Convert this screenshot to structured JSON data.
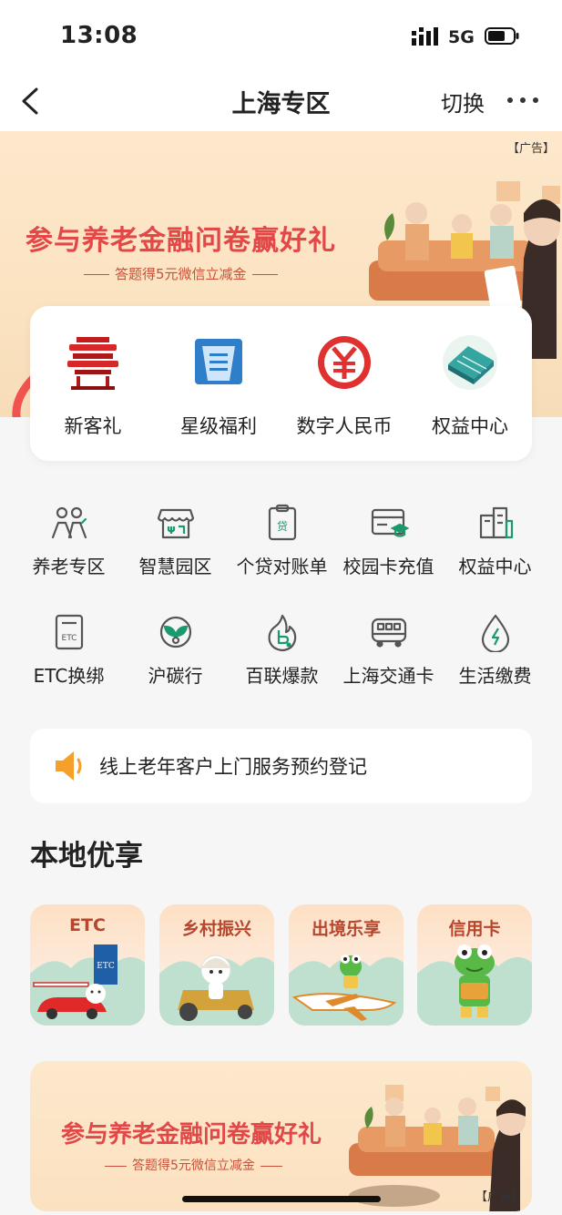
{
  "status_bar": {
    "time": "13:08",
    "network": "5G"
  },
  "nav": {
    "title": "上海专区",
    "switch_label": "切换"
  },
  "banner": {
    "title": "参与养老金融问卷赢好礼",
    "subtitle": "答题得5元微信立减金",
    "ad_tag": "【广告】"
  },
  "top_card": {
    "items": [
      {
        "label": "新客礼",
        "icon": "red-pavilion-icon"
      },
      {
        "label": "星级福利",
        "icon": "blue-building-card-icon"
      },
      {
        "label": "数字人民币",
        "icon": "digital-yuan-icon"
      },
      {
        "label": "权益中心",
        "icon": "teal-building-icon"
      }
    ]
  },
  "services": {
    "row1": [
      {
        "label": "养老专区",
        "icon": "elderly-couple-icon"
      },
      {
        "label": "智慧园区",
        "icon": "shop-icon"
      },
      {
        "label": "个贷对账单",
        "icon": "loan-statement-icon"
      },
      {
        "label": "校园卡充值",
        "icon": "campus-card-icon"
      },
      {
        "label": "权益中心",
        "icon": "buildings-icon"
      }
    ],
    "row2": [
      {
        "label": "ETC换绑",
        "icon": "etc-card-icon"
      },
      {
        "label": "沪碳行",
        "icon": "carbon-leaf-icon"
      },
      {
        "label": "百联爆款",
        "icon": "fire-b-icon"
      },
      {
        "label": "上海交通卡",
        "icon": "bus-icon"
      },
      {
        "label": "生活缴费",
        "icon": "water-drop-icon"
      }
    ],
    "etc_glyph_text": "ETC",
    "loan_glyph_text": "贷"
  },
  "notice": {
    "text": "线上老年客户上门服务预约登记"
  },
  "local": {
    "title": "本地优享",
    "tiles": [
      {
        "label": "ETC"
      },
      {
        "label": "乡村振兴"
      },
      {
        "label": "出境乐享"
      },
      {
        "label": "信用卡"
      }
    ],
    "etc_sign": "ETC"
  },
  "banner2": {
    "title": "参与养老金融问卷赢好礼",
    "subtitle": "答题得5元微信立减金",
    "ad_tag": "【广告】"
  },
  "colors": {
    "accent_red": "#e24848",
    "service_green": "#1a9a6c"
  }
}
